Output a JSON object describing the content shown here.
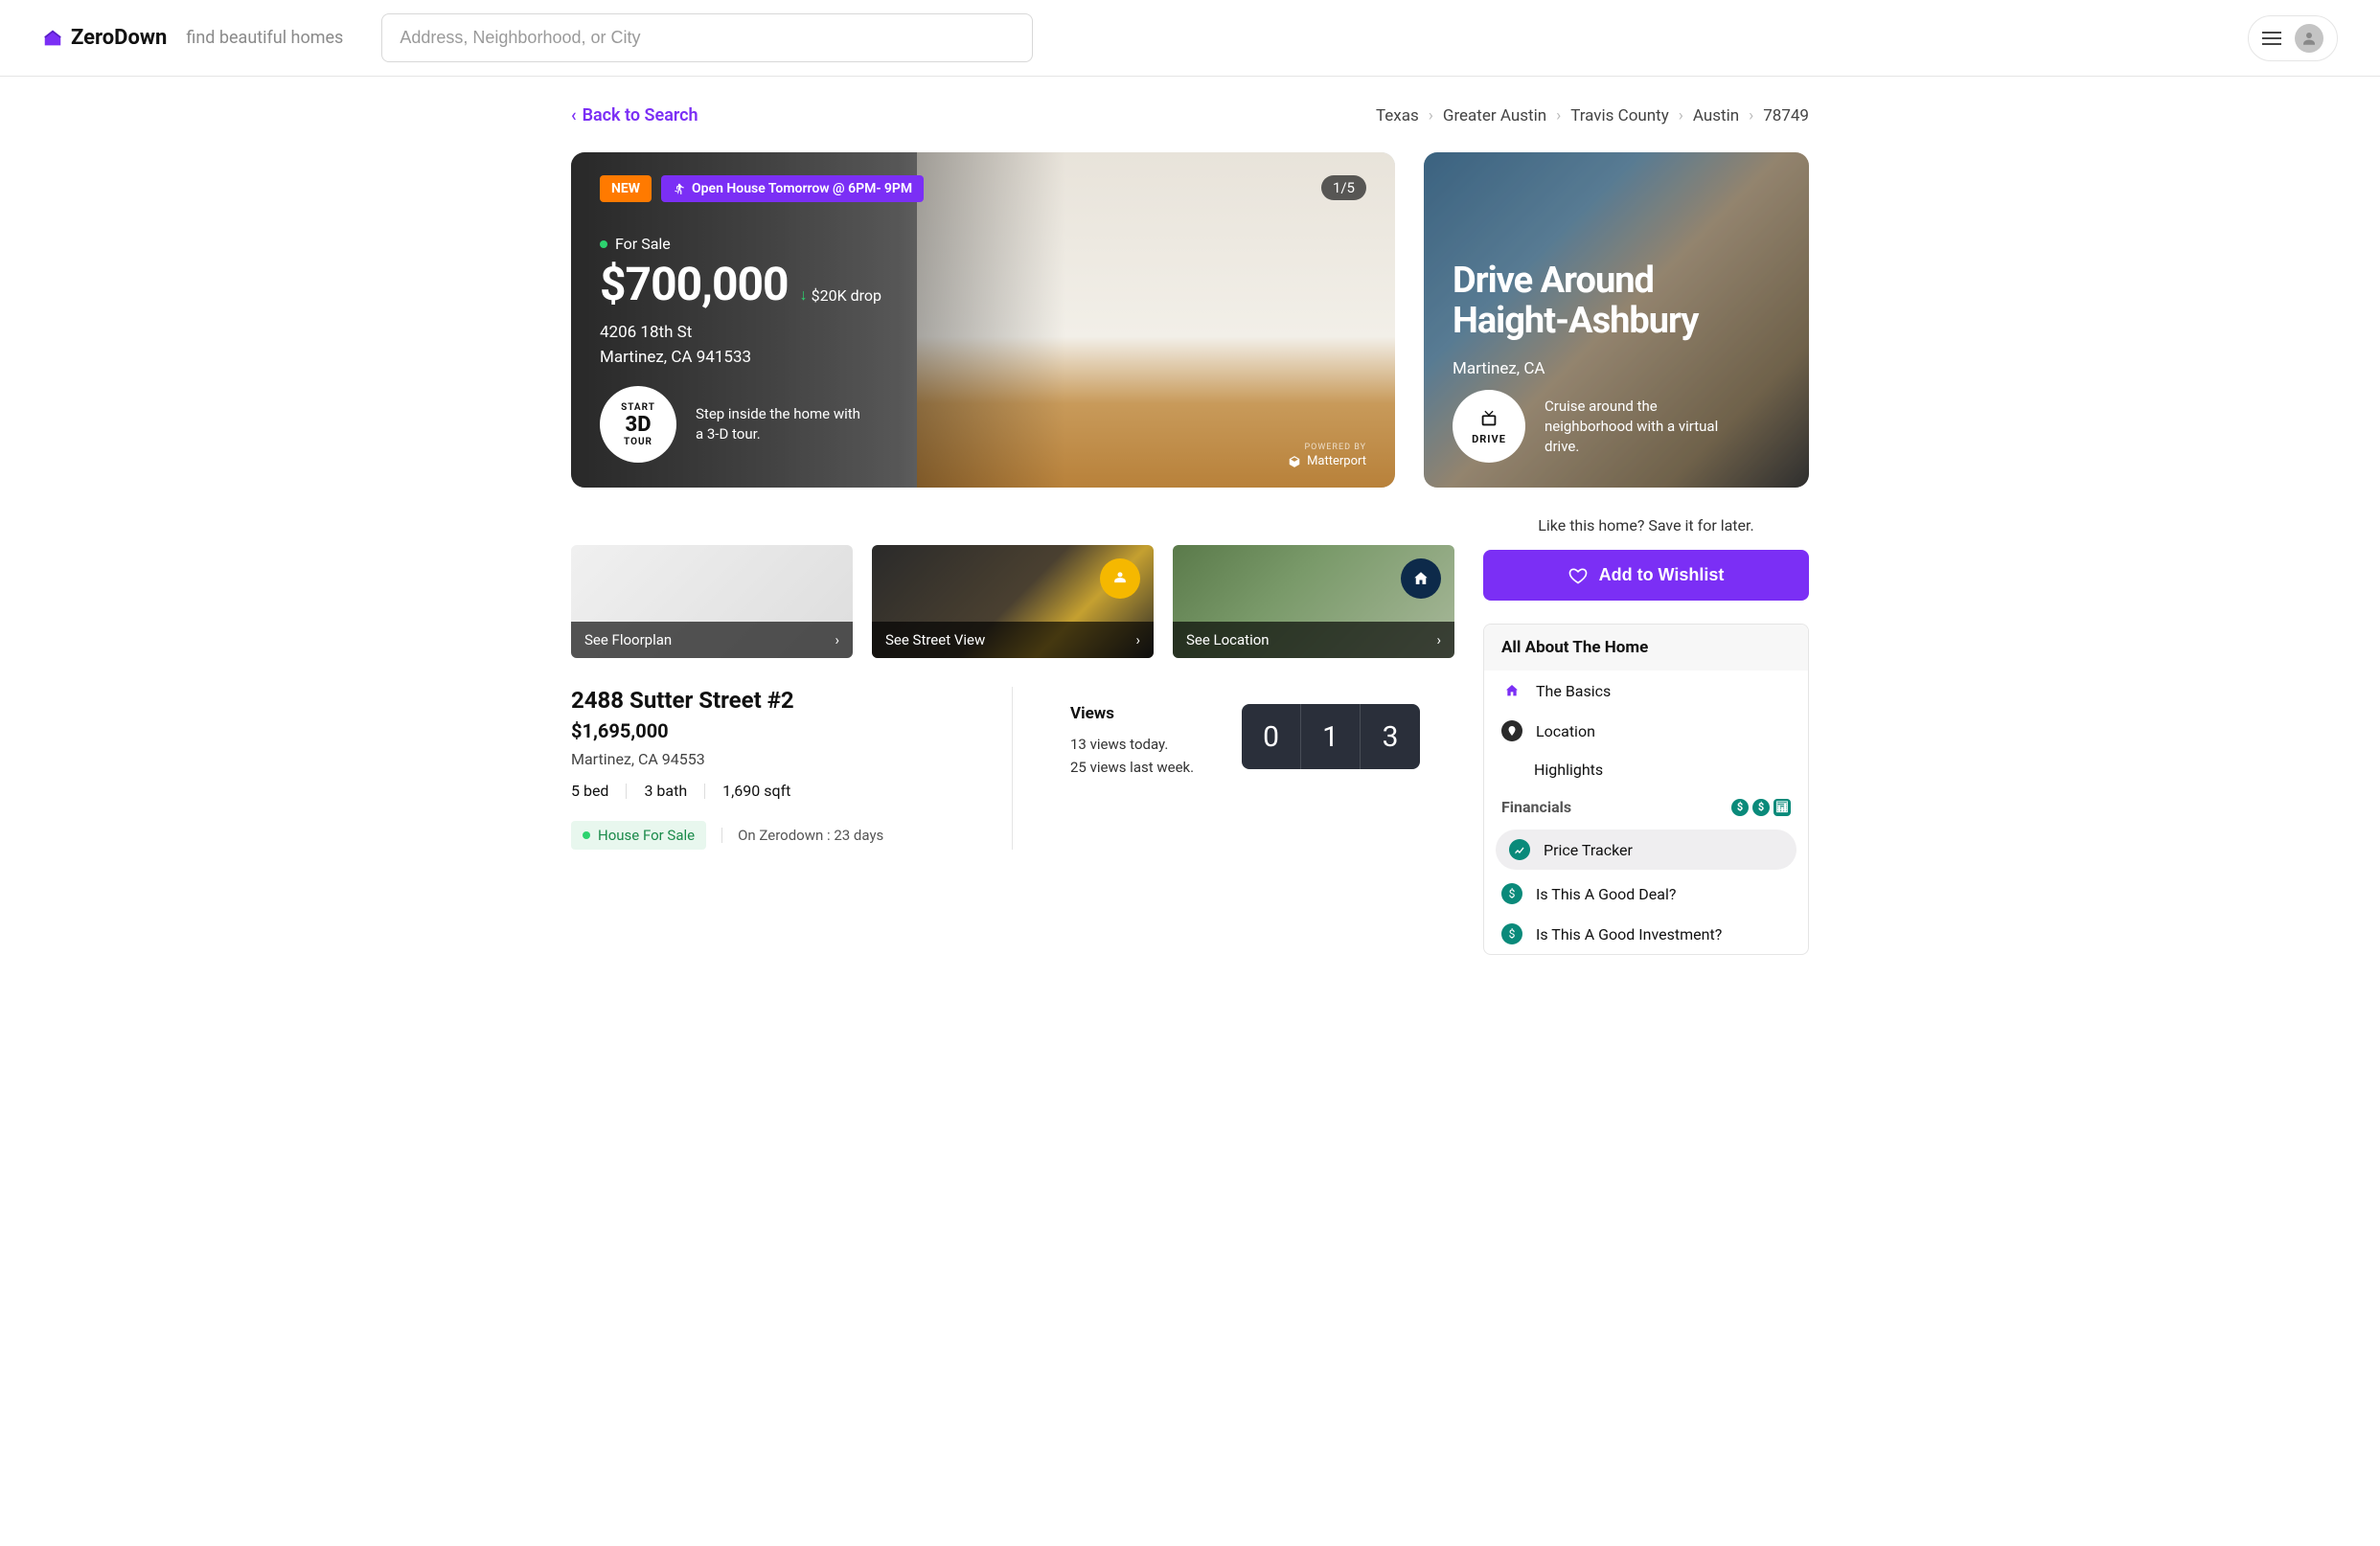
{
  "header": {
    "brand": "ZeroDown",
    "tagline": "find beautiful homes",
    "search_placeholder": "Address, Neighborhood, or City"
  },
  "back_link": "Back to Search",
  "breadcrumbs": [
    "Texas",
    "Greater Austin",
    "Travis County",
    "Austin",
    "78749"
  ],
  "hero": {
    "badge_new": "NEW",
    "badge_open": "Open House Tomorrow @ 6PM- 9PM",
    "photo_count": "1/5",
    "status": "For Sale",
    "price": "$700,000",
    "price_drop": "$20K drop",
    "address_line1": "4206 18th St",
    "address_line2": "Martinez, CA 941533",
    "tour_line1": "START",
    "tour_line2": "3D",
    "tour_line3": "TOUR",
    "tour_text": "Step inside the home with a 3-D tour.",
    "matterport_powered": "POWERED BY",
    "matterport_name": "Matterport"
  },
  "drive": {
    "title_line1": "Drive Around",
    "title_line2": "Haight-Ashbury",
    "subtitle": "Martinez, CA",
    "btn_label": "DRIVE",
    "text": "Cruise around the neighborhood with a virtual drive."
  },
  "thumbs": {
    "floorplan": "See Floorplan",
    "street": "See Street View",
    "location": "See Location"
  },
  "details": {
    "title": "2488 Sutter Street #2",
    "price": "$1,695,000",
    "address": "Martinez, CA 94553",
    "beds": "5 bed",
    "baths": "3 bath",
    "sqft": "1,690 sqft",
    "sale_tag": "House For Sale",
    "days_on": "On Zerodown : 23 days"
  },
  "views": {
    "label": "Views",
    "today": "13 views today.",
    "week": "25 views last week.",
    "counter": [
      "0",
      "1",
      "3"
    ]
  },
  "right": {
    "save_text": "Like this home? Save it for later.",
    "wishlist": "Add to Wishlist",
    "nav_header": "All About The Home",
    "items": {
      "basics": "The Basics",
      "location": "Location",
      "highlights": "Highlights",
      "financials": "Financials",
      "price_tracker": "Price Tracker",
      "good_deal": "Is This A Good Deal?",
      "good_investment": "Is This A Good Investment?"
    }
  }
}
